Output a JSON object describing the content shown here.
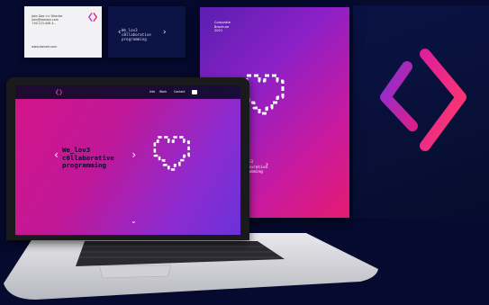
{
  "business_card": {
    "contact_lines": [
      "John Doe >> Director",
      "john@domain.com",
      "+00 123-456 4..."
    ],
    "website": "www.domain.com"
  },
  "dark_card": {
    "tagline": "We_lov3\nc0llaborative\nprogramming"
  },
  "presentation": {
    "title_lines": [
      "Corporate",
      "Brochure",
      "2021"
    ],
    "tagline": "We_lov3\nc0llaborative\nprogramming"
  },
  "laptop": {
    "nav_links": [
      "Info",
      "Work",
      "Contact"
    ],
    "hero_text": "We_lov3\nc0llaborative\nprogramming",
    "scroll_glyph": "⌄"
  },
  "colors": {
    "background": "#050a2e",
    "gradient_start": "#6a32d8",
    "gradient_mid": "#c01898",
    "gradient_end": "#e51a70",
    "accent_magenta": "#ff2fa0"
  }
}
